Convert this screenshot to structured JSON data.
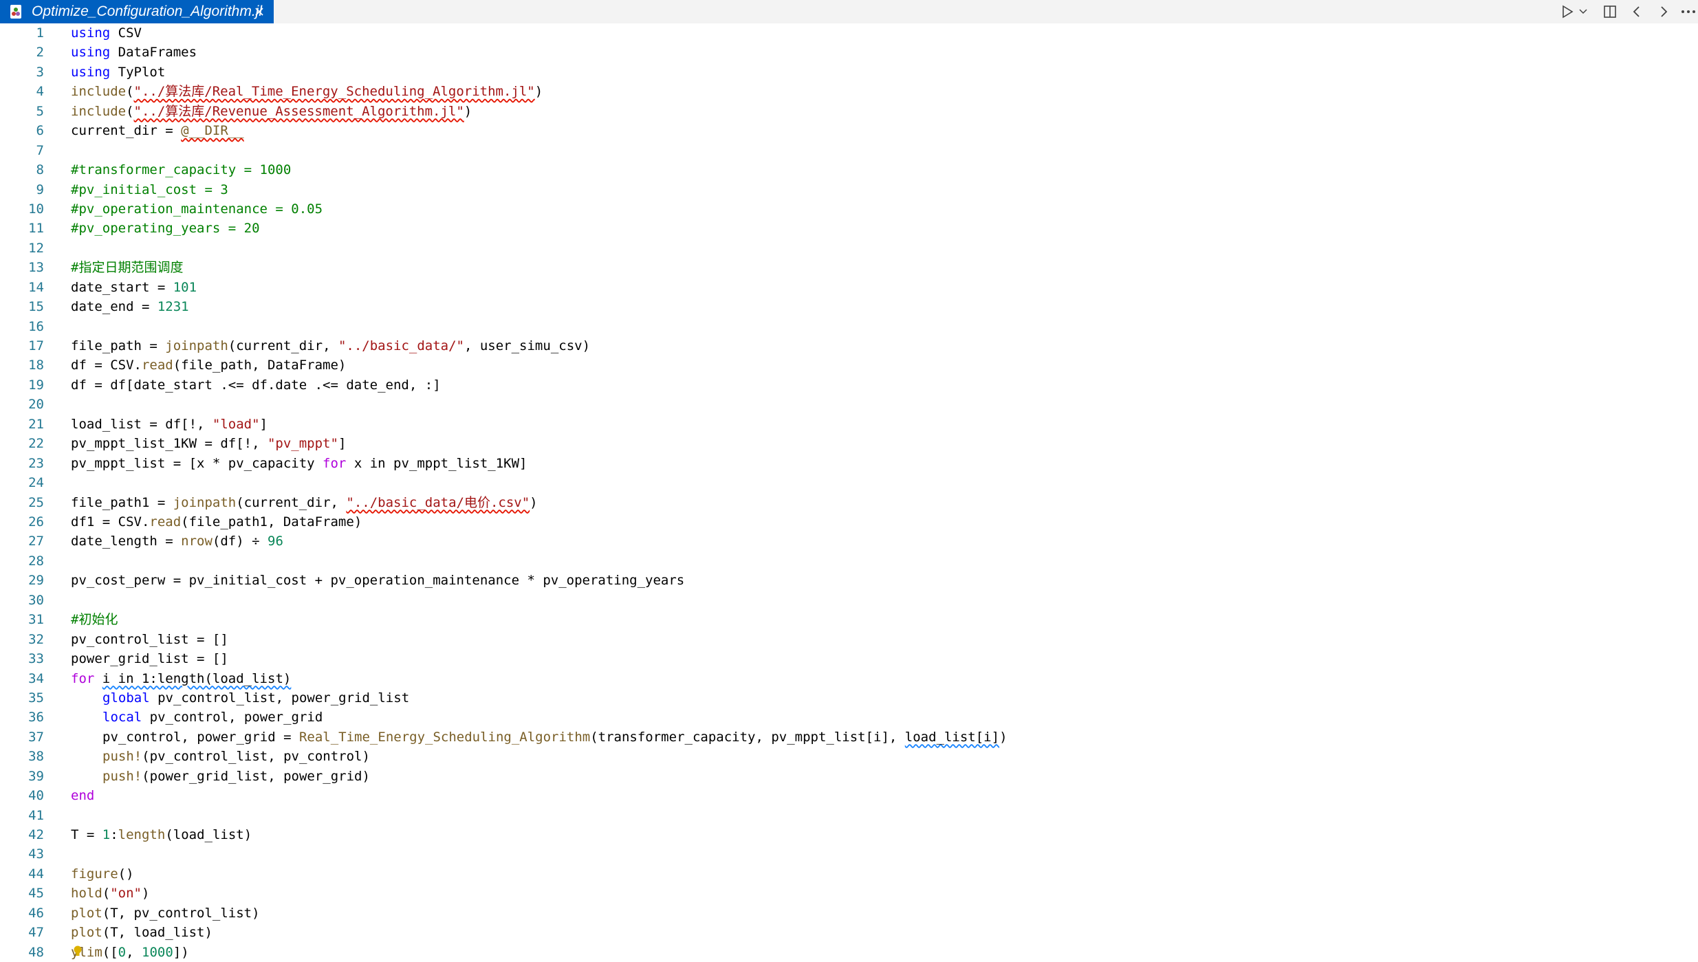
{
  "tab": {
    "title": "Optimize_Configuration_Algorithm.jl",
    "file_icon": "julia-file-icon",
    "close_icon": "close-icon"
  },
  "toolbar": {
    "run_icon": "run-icon",
    "run_dropdown_icon": "chevron-down-icon",
    "split_icon": "split-editor-icon",
    "back_icon": "arrow-left-icon",
    "forward_icon": "arrow-right-icon",
    "more_icon": "more-icon"
  },
  "colors": {
    "tab_active_bg": "#0060c0",
    "line_number": "#237893",
    "keyword": "#0000ff",
    "string": "#a31515",
    "number": "#098658",
    "function": "#795e26",
    "comment": "#008000"
  },
  "code": {
    "line_numbers": [
      "1",
      "2",
      "3",
      "4",
      "5",
      "6",
      "7",
      "8",
      "9",
      "10",
      "11",
      "12",
      "13",
      "14",
      "15",
      "16",
      "17",
      "18",
      "19",
      "20",
      "21",
      "22",
      "23",
      "24",
      "25",
      "26",
      "27",
      "28",
      "29",
      "30",
      "31",
      "32",
      "33",
      "34",
      "35",
      "36",
      "37",
      "38",
      "39",
      "40",
      "41",
      "42",
      "43",
      "44",
      "45",
      "46",
      "47",
      "48"
    ],
    "l1": {
      "kw": "using",
      "rest": " CSV"
    },
    "l2": {
      "kw": "using",
      "rest": " DataFrames"
    },
    "l3": {
      "kw": "using",
      "rest": " TyPlot"
    },
    "l4": {
      "fn": "include",
      "open": "(",
      "str": "\"../算法库/Real_Time_Energy_Scheduling_Algorithm.jl\"",
      "close": ")"
    },
    "l5": {
      "fn": "include",
      "open": "(",
      "str": "\"../算法库/Revenue_Assessment_Algorithm.jl\"",
      "close": ")"
    },
    "l6": {
      "pre": "current_dir = ",
      "mac": "@__DIR__"
    },
    "l8": "#transformer_capacity = 1000",
    "l9": "#pv_initial_cost = 3",
    "l10": "#pv_operation_maintenance = 0.05",
    "l11": "#pv_operating_years = 20",
    "l13": "#指定日期范围调度",
    "l14": {
      "pre": "date_start = ",
      "num": "101"
    },
    "l15": {
      "pre": "date_end = ",
      "num": "1231"
    },
    "l17": {
      "pre": "file_path = ",
      "fn": "joinpath",
      "mid": "(current_dir, ",
      "str": "\"../basic_data/\"",
      "post": ", user_simu_csv)"
    },
    "l18": {
      "pre": "df = CSV.",
      "fn": "read",
      "post": "(file_path, DataFrame)"
    },
    "l19": {
      "text": "df = df[date_start .<= df.date .<= date_end, :]"
    },
    "l21": {
      "pre": "load_list = df[!, ",
      "str": "\"load\"",
      "post": "]"
    },
    "l22": {
      "pre": "pv_mppt_list_1KW = df[!, ",
      "str": "\"pv_mppt\"",
      "post": "]"
    },
    "l23": {
      "pre": "pv_mppt_list = [x * pv_capacity ",
      "kw": "for",
      "mid": " x ",
      "kw2": "in",
      "post": " pv_mppt_list_1KW]"
    },
    "l25": {
      "pre": "file_path1 = ",
      "fn": "joinpath",
      "mid": "(current_dir, ",
      "str": "\"../basic_data/电价.csv\"",
      "post": ")"
    },
    "l26": {
      "pre": "df1 = CSV.",
      "fn": "read",
      "post": "(file_path1, DataFrame)"
    },
    "l27": {
      "pre": "date_length = ",
      "fn": "nrow",
      "mid": "(df) ÷ ",
      "num": "96"
    },
    "l29": {
      "text": "pv_cost_perw = pv_initial_cost + pv_operation_maintenance * pv_operating_years"
    },
    "l31": "#初始化",
    "l32": {
      "text": "pv_control_list = []"
    },
    "l33": {
      "text": "power_grid_list = []"
    },
    "l34": {
      "kw": "for",
      "sp": " ",
      "warn": "i in 1:length(load_list)"
    },
    "l35": {
      "kw": "global",
      "rest": " pv_control_list, power_grid_list"
    },
    "l36": {
      "kw": "local",
      "rest": " pv_control, power_grid"
    },
    "l37": {
      "pre": "pv_control, power_grid = ",
      "fn": "Real_Time_Energy_Scheduling_Algorithm",
      "mid": "(transformer_capacity, pv_mppt_list[i], ",
      "warn": "load_list[i]",
      "post": ")"
    },
    "l38": {
      "fn": "push!",
      "post": "(pv_control_list, pv_control)"
    },
    "l39": {
      "fn": "push!",
      "post": "(power_grid_list, power_grid)"
    },
    "l40": {
      "kw": "end"
    },
    "l42": {
      "pre": "T = ",
      "num": "1",
      "mid": ":",
      "fn": "length",
      "post": "(load_list)"
    },
    "l44": {
      "fn": "figure",
      "post": "()"
    },
    "l45": {
      "fn": "hold",
      "open": "(",
      "str": "\"on\"",
      "post": ")"
    },
    "l46": {
      "fn": "plot",
      "post": "(T, pv_control_list)"
    },
    "l47": {
      "fn": "plot",
      "post": "(T, load_list)"
    },
    "l48": {
      "fn": "ylim",
      "open": "([",
      "num": "0",
      "mid": ", ",
      "num2": "1000",
      "post": "])"
    }
  }
}
